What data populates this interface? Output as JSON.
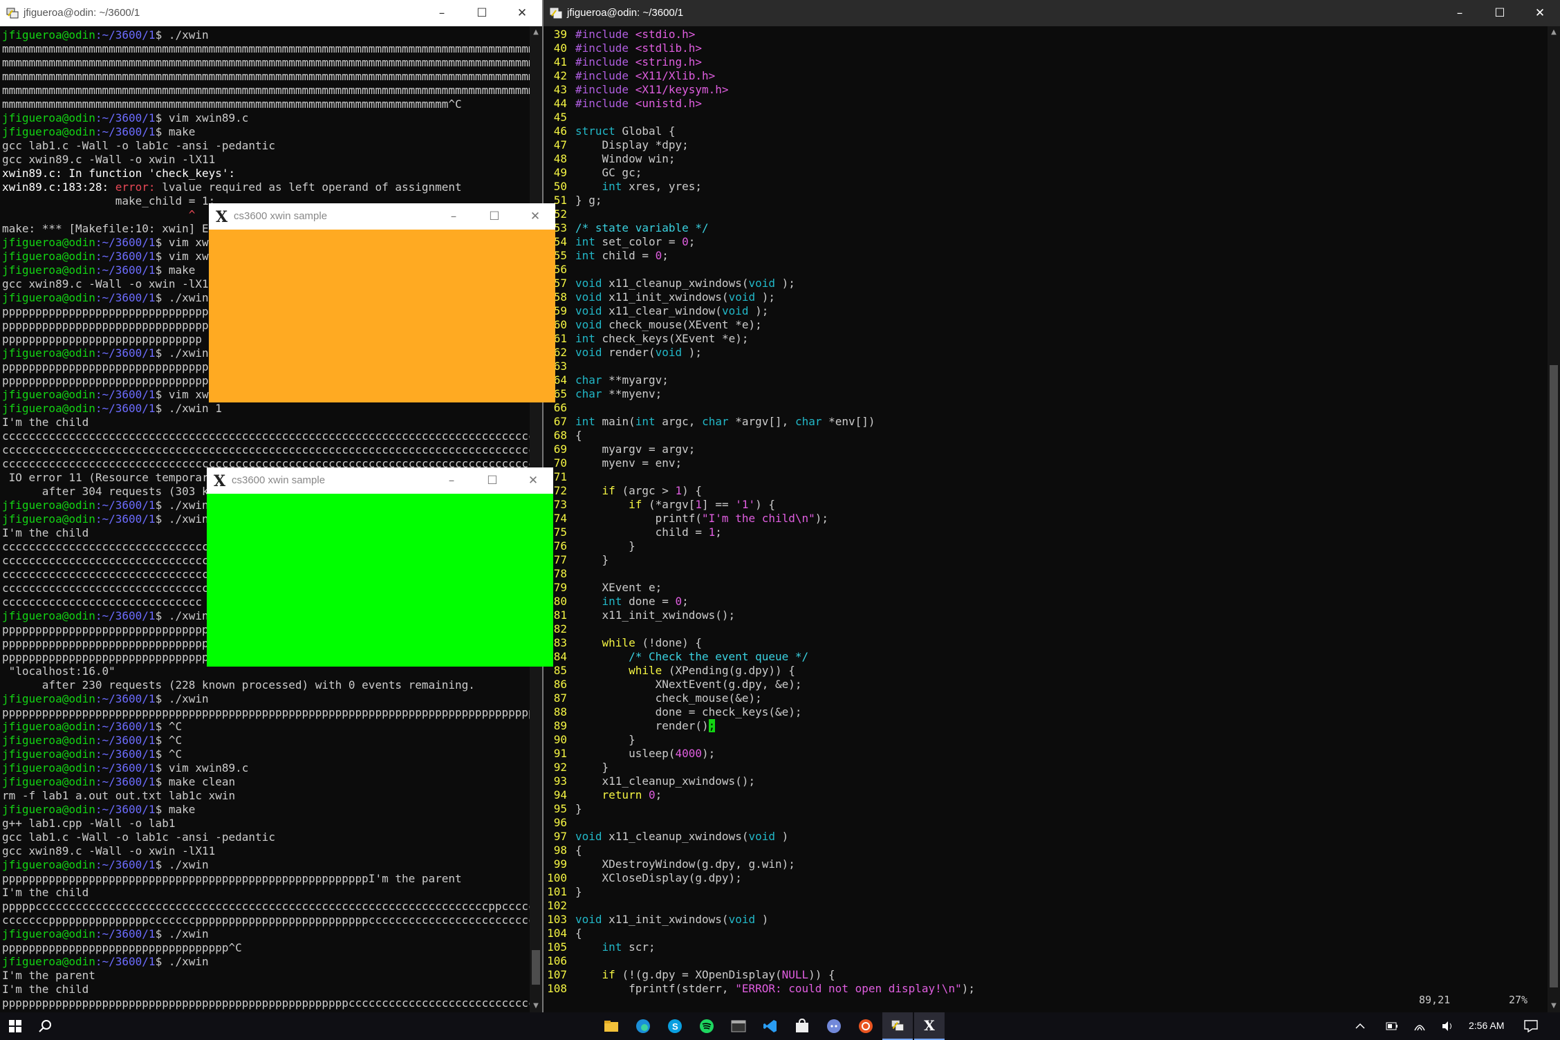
{
  "left_window": {
    "title": "jfigueroa@odin: ~/3600/1",
    "controls": {
      "minimize": "–",
      "maximize": "☐",
      "close": "✕"
    }
  },
  "right_window": {
    "title": "jfigueroa@odin: ~/3600/1",
    "controls": {
      "minimize": "–",
      "maximize": "☐",
      "close": "✕"
    }
  },
  "prompt": {
    "user_host": "jfigueroa@odin",
    "path": ":~/3600/1",
    "symbol": "$ "
  },
  "xwin_orange": {
    "title": "cs3600 xwin sample",
    "color": "#ffaa22"
  },
  "xwin_green": {
    "title": "cs3600 xwin sample",
    "color": "#00ff00"
  },
  "terminal_lines": [
    {
      "t": "prompt",
      "c": "./xwin"
    },
    {
      "t": "text",
      "c": "mmmmmmmmmmmmmmmmmmmmmmmmmmmmmmmmmmmmmmmmmmmmmmmmmmmmmmmmmmmmmmmmmmmmmmmmmmmmmmmmmmmmmmmmmmmmmmmmmmmm"
    },
    {
      "t": "text",
      "c": "mmmmmmmmmmmmmmmmmmmmmmmmmmmmmmmmmmmmmmmmmmmmmmmmmmmmmmmmmmmmmmmmmmmmmmmmmmmmmmmmmmmmmmmmmmmmmmmmmmmmmm"
    },
    {
      "t": "text",
      "c": "mmmmmmmmmmmmmmmmmmmmmmmmmmmmmmmmmmmmmmmmmmmmmmmmmmmmmmmmmmmmmmmmmmmmmmmmmmmmmmmmmmmmmmmmmmmmmmmmmmmmmm"
    },
    {
      "t": "text",
      "c": "mmmmmmmmmmmmmmmmmmmmmmmmmmmmmmmmmmmmmmmmmmmmmmmmmmmmmmmmmmmmmmmmmmmmmmmmmmmmmmmmmmmmmmmmmmmmmmmmmmmmmm"
    },
    {
      "t": "text",
      "c": "mmmmmmmmmmmmmmmmmmmmmmmmmmmmmmmmmmmmmmmmmmmmmmmmmmmmmmmmmmmmmmmmmmm^C"
    },
    {
      "t": "prompt",
      "c": "vim xwin89.c"
    },
    {
      "t": "prompt",
      "c": "make"
    },
    {
      "t": "text",
      "c": "gcc lab1.c -Wall -o lab1c -ansi -pedantic"
    },
    {
      "t": "text",
      "c": "gcc xwin89.c -Wall -o xwin -lX11"
    },
    {
      "t": "bold",
      "c": "xwin89.c: In function 'check_keys':"
    },
    {
      "t": "error",
      "a": "xwin89.c:183:28: ",
      "b": "error: ",
      "c": "lvalue required as left operand of assignment"
    },
    {
      "t": "text",
      "c": "                 make_child = 1;"
    },
    {
      "t": "caret",
      "c": "                            ^"
    },
    {
      "t": "text",
      "c": "make: *** [Makefile:10: xwin] Error 1"
    },
    {
      "t": "prompt",
      "c": "vim xwin89.c"
    },
    {
      "t": "prompt",
      "c": "vim xwin89.c"
    },
    {
      "t": "prompt",
      "c": "make"
    },
    {
      "t": "text",
      "c": "gcc xwin89.c -Wall -o xwin -lX11"
    },
    {
      "t": "prompt",
      "c": "./xwin"
    },
    {
      "t": "text",
      "c": "pppppppppppppppppppppppppppppppppppppppppppppppppppppppppppppppppppppppppppppppppppppppppppppppppppppppppppppppp"
    },
    {
      "t": "text",
      "c": "pppppppppppppppppppppppppppppppppppppppppppppppppppppppppppppppppppppppppppppppppppppppppppppppppppppppppppppppp"
    },
    {
      "t": "text",
      "c": "pppppppppppppppppppppppppppppp"
    },
    {
      "t": "prompt",
      "c": "./xwin"
    },
    {
      "t": "text",
      "c": "pppppppppppppppppppppppppppppppppppppppppppppppppppppppppppppppppppppppppppppppppppppppppppppppppppppppppppppppp"
    },
    {
      "t": "text",
      "c": "pppppppppppppppppppppppppppppppppppppppppppppppppppppppppppppppppppppppppppppppppppppppppppp^C"
    },
    {
      "t": "prompt",
      "c": "vim xwin89.c"
    },
    {
      "t": "prompt",
      "c": "./xwin 1"
    },
    {
      "t": "text",
      "c": "I'm the child"
    },
    {
      "t": "text",
      "c": "cccccccccccccccccccccccccccccccccccccccccccccccccccccccccccccccccccccccccccccccccccccccccccccccccccccccccccccccc"
    },
    {
      "t": "text",
      "c": "cccccccccccccccccccccccccccccccccccccccccccccccccccccccccccccccccccccccccccccccccccccccccccccccccccccccccccccccc"
    },
    {
      "t": "text",
      "c": "cccccccccccccccccccccccccccccccccccccccccccccccccccccccccccccccccccccccccccccccccccccccccccccccccccccccXIO:  fatal"
    },
    {
      "t": "text",
      "c": " IO error 11 (Resource temporarily unavailable) on X server \"localhost:16.0\""
    },
    {
      "t": "text",
      "c": "      after 304 requests (303 known processed) with 0 events remaining."
    },
    {
      "t": "prompt",
      "c": "./xwin"
    },
    {
      "t": "prompt",
      "c": "./xwin 1"
    },
    {
      "t": "text",
      "c": "I'm the child"
    },
    {
      "t": "text",
      "c": "cccccccccccccccccccccccccccccccccccccccccccccccccccccccccccccccccccccccccccccccccccccccccccccccccccccccccccccccc"
    },
    {
      "t": "text",
      "c": "cccccccccccccccccccccccccccccccccccccccccccccccccccccccccccccccccccccccccccccccccccccccccccccccccccccccccccccccc"
    },
    {
      "t": "text",
      "c": "cccccccccccccccccccccccccccccccccccccccccccccccccccccccccccccccccccccccccccccccccccccccccccccccccccccccccccccccc"
    },
    {
      "t": "text",
      "c": "cccccccccccccccccccccccccccccccccccccccccccccccccccccccccccccccccccccccccccccccccccccccccccccccccccccccccccccccc"
    },
    {
      "t": "text",
      "c": "cccccccccccccccccccccccccccccc"
    },
    {
      "t": "prompt",
      "c": "./xwin"
    },
    {
      "t": "text",
      "c": "pppppppppppppppppppppppppppppppppppppppppppppppppppppppppppppppppppppppppppppppppppppppppppppppppppppppppppppppp"
    },
    {
      "t": "text",
      "c": "pppppppppppppppppppppppppppppppppppppppppppppppppppppppppppppppppppppppppppppppppppppppppppppppppppppppppppppppp"
    },
    {
      "t": "text",
      "c": "pppppppppppppppppppppppppppppppppppppppppppppppppppppppppppppppppppppppparily unavailable) on X server"
    },
    {
      "t": "text",
      "c": " \"localhost:16.0\""
    },
    {
      "t": "text",
      "c": "      after 230 requests (228 known processed) with 0 events remaining."
    },
    {
      "t": "prompt",
      "c": "./xwin"
    },
    {
      "t": "text",
      "c": "ppppppppppppppppppppppppppppppppppppppppppppppppppppppppppppppppppppppppppppppppppppppppp^[[A^[[B^[[B^[[B^C"
    },
    {
      "t": "prompt",
      "c": "^C"
    },
    {
      "t": "prompt",
      "c": "^C"
    },
    {
      "t": "prompt",
      "c": "^C"
    },
    {
      "t": "prompt",
      "c": "vim xwin89.c"
    },
    {
      "t": "prompt",
      "c": "make clean"
    },
    {
      "t": "text",
      "c": "rm -f lab1 a.out out.txt lab1c xwin"
    },
    {
      "t": "prompt",
      "c": "make"
    },
    {
      "t": "text",
      "c": "g++ lab1.cpp -Wall -o lab1"
    },
    {
      "t": "text",
      "c": "gcc lab1.c -Wall -o lab1c -ansi -pedantic"
    },
    {
      "t": "text",
      "c": "gcc xwin89.c -Wall -o xwin -lX11"
    },
    {
      "t": "prompt",
      "c": "./xwin"
    },
    {
      "t": "text",
      "c": "pppppppppppppppppppppppppppppppppppppppppppppppppppppppI'm the parent"
    },
    {
      "t": "text",
      "c": "I'm the child"
    },
    {
      "t": "text",
      "c": "pppppccccccccccccccccccccccccccccccccccccccccccccccccccccccccccccccccccccppccccccccccccccccccccppppppppppppppppppp"
    },
    {
      "t": "text",
      "c": "cccccccpppppppppppppppcccccccppppppppppppppppppppppppppccccccccccccccccccccccccccccppppppppppppppppppppppp^C"
    },
    {
      "t": "prompt",
      "c": "./xwin"
    },
    {
      "t": "text",
      "c": "pppppppppppppppppppppppppppppppppp^C"
    },
    {
      "t": "prompt",
      "c": "./xwin"
    },
    {
      "t": "text",
      "c": "I'm the parent"
    },
    {
      "t": "text",
      "c": "I'm the child"
    },
    {
      "t": "text",
      "c": "ppppppppppppppppppppppppppppppppppppppppppppppppppppcccccccccccccccccccccccccccccccccc"
    }
  ],
  "vim_lines": [
    {
      "n": "39",
      "h": [
        [
          "pp",
          "#include "
        ],
        [
          "str",
          "<stdio.h>"
        ]
      ]
    },
    {
      "n": "40",
      "h": [
        [
          "pp",
          "#include "
        ],
        [
          "str",
          "<stdlib.h>"
        ]
      ]
    },
    {
      "n": "41",
      "h": [
        [
          "pp",
          "#include "
        ],
        [
          "str",
          "<string.h>"
        ]
      ]
    },
    {
      "n": "42",
      "h": [
        [
          "pp",
          "#include "
        ],
        [
          "str",
          "<X11/Xlib.h>"
        ]
      ]
    },
    {
      "n": "43",
      "h": [
        [
          "pp",
          "#include "
        ],
        [
          "str",
          "<X11/keysym.h>"
        ]
      ]
    },
    {
      "n": "44",
      "h": [
        [
          "pp",
          "#include "
        ],
        [
          "str",
          "<unistd.h>"
        ]
      ]
    },
    {
      "n": "45",
      "h": []
    },
    {
      "n": "46",
      "h": [
        [
          "ty",
          "struct"
        ],
        [
          "",
          "Global {"
        ]
      ]
    },
    {
      "n": "47",
      "h": [
        [
          "",
          "    Display *dpy;"
        ]
      ]
    },
    {
      "n": "48",
      "h": [
        [
          "",
          "    Window win;"
        ]
      ]
    },
    {
      "n": "49",
      "h": [
        [
          "",
          "    GC gc;"
        ]
      ]
    },
    {
      "n": "50",
      "h": [
        [
          "",
          "    "
        ],
        [
          "ty",
          "int"
        ],
        [
          "",
          "xres, yres;"
        ]
      ]
    },
    {
      "n": "51",
      "h": [
        [
          "",
          "} g;"
        ]
      ]
    },
    {
      "n": "52",
      "h": []
    },
    {
      "n": "53",
      "h": [
        [
          "cm",
          "/* state variable */"
        ]
      ]
    },
    {
      "n": "54",
      "h": [
        [
          "ty",
          "int"
        ],
        [
          "",
          "set_color = "
        ],
        [
          "num",
          "0"
        ],
        [
          "",
          ";"
        ]
      ]
    },
    {
      "n": "55",
      "h": [
        [
          "ty",
          "int"
        ],
        [
          "",
          "child = "
        ],
        [
          "num",
          "0"
        ],
        [
          "",
          ";"
        ]
      ]
    },
    {
      "n": "56",
      "h": []
    },
    {
      "n": "57",
      "h": [
        [
          "ty",
          "void"
        ],
        [
          "",
          "x11_cleanup_xwindows("
        ],
        [
          "ty",
          "void"
        ],
        [
          "",
          ");"
        ]
      ]
    },
    {
      "n": "58",
      "h": [
        [
          "ty",
          "void"
        ],
        [
          "",
          "x11_init_xwindows("
        ],
        [
          "ty",
          "void"
        ],
        [
          "",
          ");"
        ]
      ]
    },
    {
      "n": "59",
      "h": [
        [
          "ty",
          "void"
        ],
        [
          "",
          "x11_clear_window("
        ],
        [
          "ty",
          "void"
        ],
        [
          "",
          ");"
        ]
      ]
    },
    {
      "n": "60",
      "h": [
        [
          "ty",
          "void"
        ],
        [
          "",
          "check_mouse(XEvent *e);"
        ]
      ]
    },
    {
      "n": "61",
      "h": [
        [
          "ty",
          "int"
        ],
        [
          "",
          "check_keys(XEvent *e);"
        ]
      ]
    },
    {
      "n": "62",
      "h": [
        [
          "ty",
          "void"
        ],
        [
          "",
          "render("
        ],
        [
          "ty",
          "void"
        ],
        [
          "",
          ");"
        ]
      ]
    },
    {
      "n": "63",
      "h": []
    },
    {
      "n": "64",
      "h": [
        [
          "ty",
          "char"
        ],
        [
          "",
          "**myargv;"
        ]
      ]
    },
    {
      "n": "65",
      "h": [
        [
          "ty",
          "char"
        ],
        [
          "",
          "**myenv;"
        ]
      ]
    },
    {
      "n": "66",
      "h": []
    },
    {
      "n": "67",
      "h": [
        [
          "ty",
          "int"
        ],
        [
          "",
          "main("
        ],
        [
          "ty",
          "int"
        ],
        [
          "",
          "argc, "
        ],
        [
          "ty",
          "char"
        ],
        [
          "",
          "*argv[], "
        ],
        [
          "ty",
          "char"
        ],
        [
          "",
          "*env[])"
        ]
      ]
    },
    {
      "n": "68",
      "h": [
        [
          "",
          "{"
        ]
      ]
    },
    {
      "n": "69",
      "h": [
        [
          "",
          "    myargv = argv;"
        ]
      ]
    },
    {
      "n": "70",
      "h": [
        [
          "",
          "    myenv = env;"
        ]
      ]
    },
    {
      "n": "71",
      "h": []
    },
    {
      "n": "72",
      "h": [
        [
          "",
          "    "
        ],
        [
          "kw",
          "if"
        ],
        [
          "",
          "(argc > "
        ],
        [
          "num",
          "1"
        ],
        [
          "",
          ") {"
        ]
      ]
    },
    {
      "n": "73",
      "h": [
        [
          "",
          "        "
        ],
        [
          "kw",
          "if"
        ],
        [
          "",
          "(*argv["
        ],
        [
          "num",
          "1"
        ],
        [
          "",
          "] == "
        ],
        [
          "num",
          "'1'"
        ],
        [
          "",
          ") {"
        ]
      ]
    },
    {
      "n": "74",
      "h": [
        [
          "",
          "            printf("
        ],
        [
          "str",
          "\"I'm the child\\n\""
        ],
        [
          "",
          ");"
        ]
      ]
    },
    {
      "n": "75",
      "h": [
        [
          "",
          "            child = "
        ],
        [
          "num",
          "1"
        ],
        [
          "",
          ";"
        ]
      ]
    },
    {
      "n": "76",
      "h": [
        [
          "",
          "        }"
        ]
      ]
    },
    {
      "n": "77",
      "h": [
        [
          "",
          "    }"
        ]
      ]
    },
    {
      "n": "78",
      "h": []
    },
    {
      "n": "79",
      "h": [
        [
          "",
          "    XEvent e;"
        ]
      ]
    },
    {
      "n": "80",
      "h": [
        [
          "",
          "    "
        ],
        [
          "ty",
          "int"
        ],
        [
          "",
          "done = "
        ],
        [
          "num",
          "0"
        ],
        [
          "",
          ";"
        ]
      ]
    },
    {
      "n": "81",
      "h": [
        [
          "",
          "    x11_init_xwindows();"
        ]
      ]
    },
    {
      "n": "82",
      "h": []
    },
    {
      "n": "83",
      "h": [
        [
          "",
          "    "
        ],
        [
          "kw",
          "while"
        ],
        [
          "",
          "(!done) {"
        ]
      ]
    },
    {
      "n": "84",
      "h": [
        [
          "",
          "        "
        ],
        [
          "cm",
          "/* Check the event queue */"
        ]
      ]
    },
    {
      "n": "85",
      "h": [
        [
          "",
          "        "
        ],
        [
          "kw",
          "while"
        ],
        [
          "",
          "(XPending(g.dpy)) {"
        ]
      ]
    },
    {
      "n": "86",
      "h": [
        [
          "",
          "            XNextEvent(g.dpy, &e);"
        ]
      ]
    },
    {
      "n": "87",
      "h": [
        [
          "",
          "            check_mouse(&e);"
        ]
      ]
    },
    {
      "n": "88",
      "h": [
        [
          "",
          "            done = check_keys(&e);"
        ]
      ]
    },
    {
      "n": "89",
      "h": [
        [
          "",
          "            render()"
        ],
        [
          "cur",
          ";"
        ]
      ]
    },
    {
      "n": "90",
      "h": [
        [
          "",
          "        }"
        ]
      ]
    },
    {
      "n": "91",
      "h": [
        [
          "",
          "        usleep("
        ],
        [
          "num",
          "4000"
        ],
        [
          "",
          ");"
        ]
      ]
    },
    {
      "n": "92",
      "h": [
        [
          "",
          "    }"
        ]
      ]
    },
    {
      "n": "93",
      "h": [
        [
          "",
          "    x11_cleanup_xwindows();"
        ]
      ]
    },
    {
      "n": "94",
      "h": [
        [
          "",
          "    "
        ],
        [
          "kw",
          "return"
        ],
        [
          "num",
          "0"
        ],
        [
          "",
          ";"
        ]
      ]
    },
    {
      "n": "95",
      "h": [
        [
          "",
          "}"
        ]
      ]
    },
    {
      "n": "96",
      "h": []
    },
    {
      "n": "97",
      "h": [
        [
          "ty",
          "void"
        ],
        [
          "",
          "x11_cleanup_xwindows("
        ],
        [
          "ty",
          "void"
        ],
        [
          "",
          ")"
        ]
      ]
    },
    {
      "n": "98",
      "h": [
        [
          "",
          "{"
        ]
      ]
    },
    {
      "n": "99",
      "h": [
        [
          "",
          "    XDestroyWindow(g.dpy, g.win);"
        ]
      ]
    },
    {
      "n": "100",
      "h": [
        [
          "",
          "    XCloseDisplay(g.dpy);"
        ]
      ]
    },
    {
      "n": "101",
      "h": [
        [
          "",
          "}"
        ]
      ]
    },
    {
      "n": "102",
      "h": []
    },
    {
      "n": "103",
      "h": [
        [
          "ty",
          "void"
        ],
        [
          "",
          "x11_init_xwindows("
        ],
        [
          "ty",
          "void"
        ],
        [
          "",
          ")"
        ]
      ]
    },
    {
      "n": "104",
      "h": [
        [
          "",
          "{"
        ]
      ]
    },
    {
      "n": "105",
      "h": [
        [
          "",
          "    "
        ],
        [
          "ty",
          "int"
        ],
        [
          "",
          "scr;"
        ]
      ]
    },
    {
      "n": "106",
      "h": []
    },
    {
      "n": "107",
      "h": [
        [
          "",
          "    "
        ],
        [
          "kw",
          "if"
        ],
        [
          "",
          "(!(g.dpy = XOpenDisplay("
        ],
        [
          "num",
          "NULL"
        ],
        [
          "",
          ")) {"
        ]
      ]
    },
    {
      "n": "108",
      "h": [
        [
          "",
          "        fprintf(stderr, "
        ],
        [
          "str",
          "\"ERROR: could not open display!\\n\""
        ],
        [
          "",
          ");"
        ]
      ]
    }
  ],
  "vim_status": {
    "position": "89,21",
    "percent": "27%"
  },
  "taskbar": {
    "time": "2:56 AM",
    "icons": [
      "windows-start-icon",
      "search-icon",
      "file-explorer-icon",
      "edge-icon",
      "skype-icon",
      "spotify-icon",
      "terminal-icon",
      "vscode-icon",
      "store-icon",
      "discord-icon",
      "ubuntu-icon",
      "putty-icon",
      "xwin-icon"
    ],
    "tray_icons": [
      "chevron-up-icon",
      "battery-icon",
      "wifi-icon",
      "volume-icon"
    ]
  }
}
